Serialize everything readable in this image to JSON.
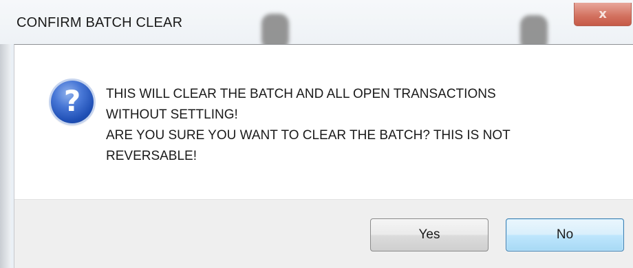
{
  "window": {
    "title": "CONFIRM BATCH CLEAR",
    "close_glyph": "x"
  },
  "dialog": {
    "icon": "question-icon",
    "icon_glyph": "?",
    "message_lines": [
      "THIS WILL CLEAR THE BATCH AND ALL OPEN TRANSACTIONS",
      "WITHOUT SETTLING!",
      "ARE YOU SURE YOU WANT TO CLEAR THE BATCH?  THIS IS NOT",
      "REVERSABLE!"
    ]
  },
  "buttons": {
    "yes_label": "Yes",
    "no_label": "No"
  },
  "colors": {
    "close_button": "#d2705e",
    "default_button_border": "#3c7fb1",
    "icon_blue": "#1f4fb5"
  }
}
